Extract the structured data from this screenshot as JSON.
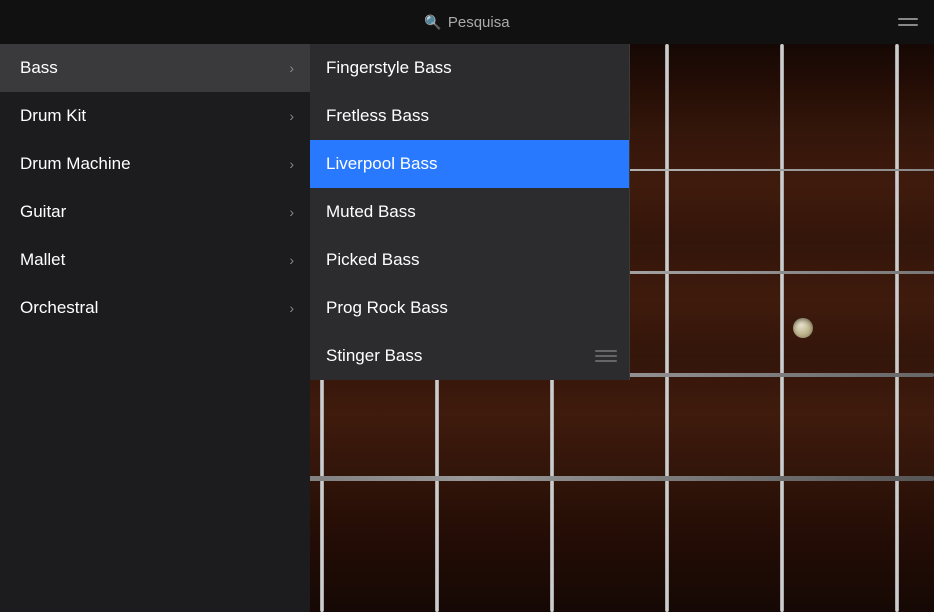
{
  "topbar": {
    "search_placeholder": "Pesquisa",
    "search_icon": "🔍"
  },
  "sidebar": {
    "items": [
      {
        "id": "bass",
        "label": "Bass",
        "active": true,
        "has_submenu": true
      },
      {
        "id": "drum-kit",
        "label": "Drum Kit",
        "active": false,
        "has_submenu": true
      },
      {
        "id": "drum-machine",
        "label": "Drum Machine",
        "active": false,
        "has_submenu": true
      },
      {
        "id": "guitar",
        "label": "Guitar",
        "active": false,
        "has_submenu": true
      },
      {
        "id": "mallet",
        "label": "Mallet",
        "active": false,
        "has_submenu": true
      },
      {
        "id": "orchestral",
        "label": "Orchestral",
        "active": false,
        "has_submenu": true
      }
    ]
  },
  "dropdown": {
    "items": [
      {
        "id": "fingerstyle-bass",
        "label": "Fingerstyle Bass",
        "selected": false
      },
      {
        "id": "fretless-bass",
        "label": "Fretless Bass",
        "selected": false
      },
      {
        "id": "liverpool-bass",
        "label": "Liverpool Bass",
        "selected": true
      },
      {
        "id": "muted-bass",
        "label": "Muted Bass",
        "selected": false
      },
      {
        "id": "picked-bass",
        "label": "Picked Bass",
        "selected": false
      },
      {
        "id": "prog-rock-bass",
        "label": "Prog Rock Bass",
        "selected": false
      },
      {
        "id": "stinger-bass",
        "label": "Stinger Bass",
        "selected": false
      }
    ]
  },
  "frets": {
    "positions": [
      95,
      210,
      325,
      440,
      555,
      670,
      785,
      900
    ],
    "markers": [
      {
        "fret_index": 2,
        "string": "middle"
      },
      {
        "fret_index": 4,
        "string": "middle"
      },
      {
        "fret_index": 6,
        "string": "middle"
      }
    ]
  },
  "strings": {
    "items": [
      {
        "id": "string1",
        "top_pct": 20,
        "thickness": 2,
        "color": "#c0c0c0"
      },
      {
        "id": "string2",
        "top_pct": 40,
        "thickness": 3,
        "color": "#b0b0b0"
      },
      {
        "id": "string3",
        "top_pct": 60,
        "thickness": 4,
        "color": "#a0a0a0"
      },
      {
        "id": "string4",
        "top_pct": 80,
        "thickness": 5,
        "color": "#909090"
      }
    ]
  },
  "pegs": [
    {
      "id": "peg1",
      "top_pct": 15
    },
    {
      "id": "peg2",
      "top_pct": 72
    }
  ]
}
